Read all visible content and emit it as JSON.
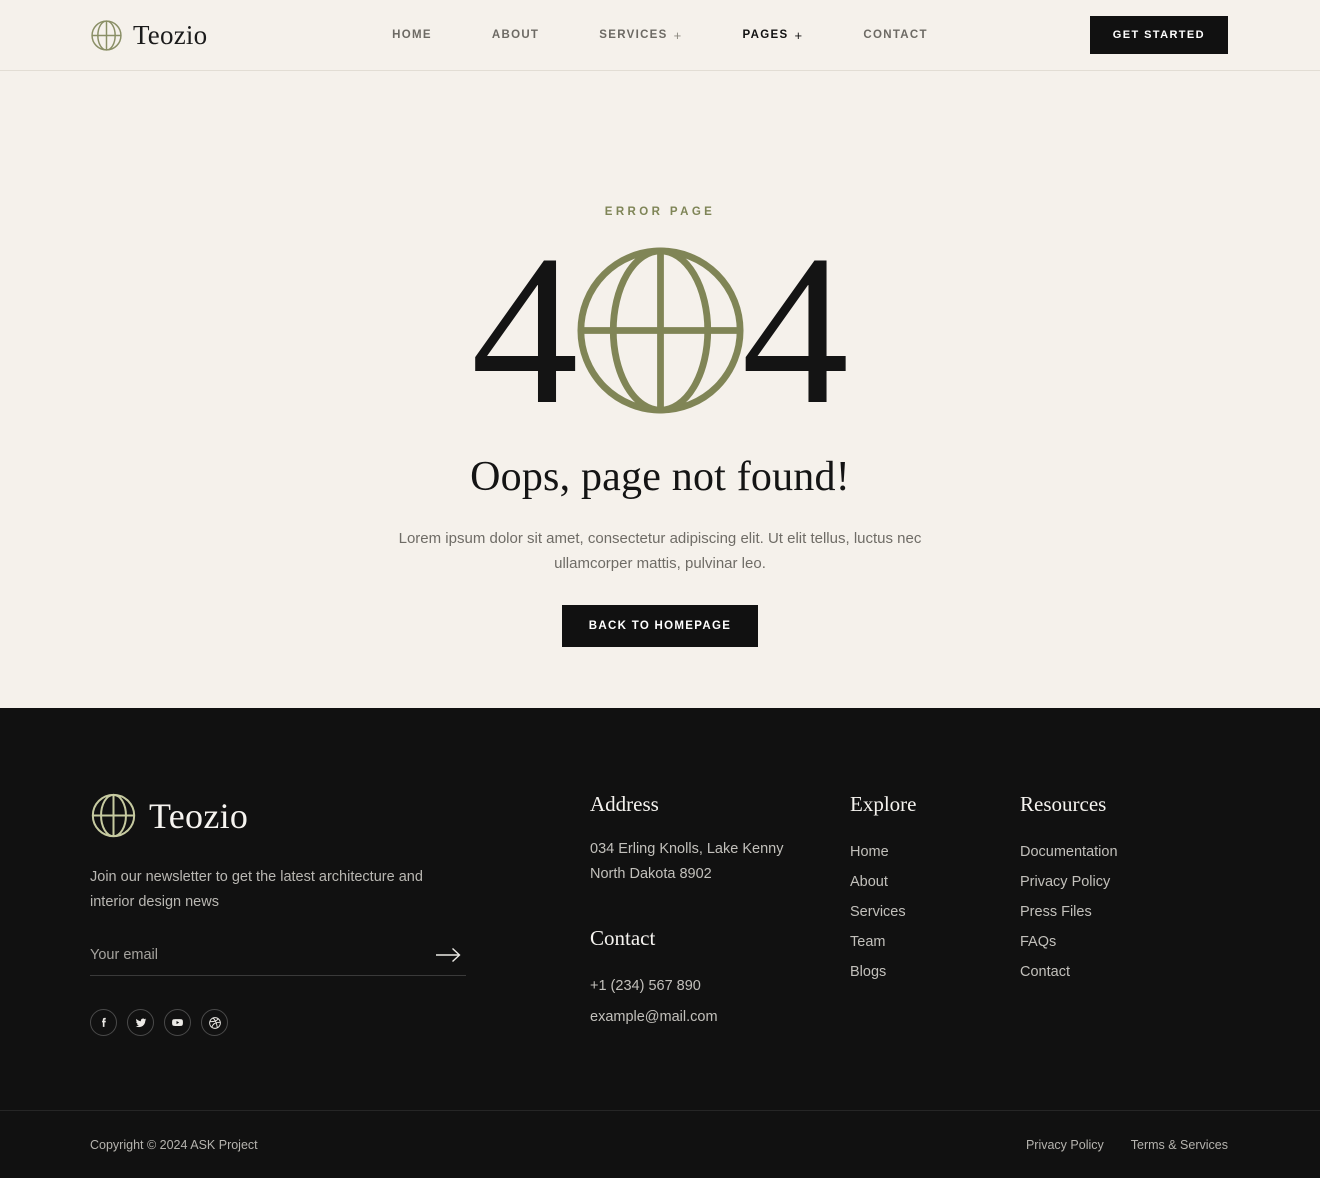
{
  "brand": {
    "name": "Teozio",
    "mark_icon": "circle-cross-logo-icon"
  },
  "header": {
    "nav": [
      {
        "label": "HOME",
        "has_plus": false,
        "active": false
      },
      {
        "label": "ABOUT",
        "has_plus": false,
        "active": false
      },
      {
        "label": "SERVICES",
        "has_plus": true,
        "active": false
      },
      {
        "label": "PAGES",
        "has_plus": true,
        "active": true
      },
      {
        "label": "CONTACT",
        "has_plus": false,
        "active": false
      }
    ],
    "plus_glyph": "+",
    "cta_label": "GET STARTED"
  },
  "hero": {
    "eyebrow": "ERROR PAGE",
    "code_left": "4",
    "code_right": "4",
    "code_middle_icon": "circle-cross-logo-icon",
    "title": "Oops, page not found!",
    "description": "Lorem ipsum dolor sit amet, consectetur adipiscing elit. Ut elit tellus, luctus nec ullamcorper mattis, pulvinar leo.",
    "button_label": "BACK TO HOMEPAGE"
  },
  "footer": {
    "brand_name": "Teozio",
    "newsletter_text": "Join our newsletter to get the latest architecture and interior design news",
    "email_placeholder": "Your email",
    "email_value": "",
    "submit_icon": "arrow-right-icon",
    "socials": [
      {
        "name": "facebook-icon",
        "glyph": "f"
      },
      {
        "name": "twitter-icon",
        "glyph": "t"
      },
      {
        "name": "youtube-icon",
        "glyph": "y"
      },
      {
        "name": "dribbble-icon",
        "glyph": "d"
      }
    ],
    "address": {
      "heading": "Address",
      "line1": "034 Erling Knolls, Lake Kenny",
      "line2": "North Dakota 8902"
    },
    "contact": {
      "heading": "Contact",
      "phone": "+1 (234) 567 890",
      "email": "example@mail.com"
    },
    "explore": {
      "heading": "Explore",
      "links": [
        "Home",
        "About",
        "Services",
        "Team",
        "Blogs"
      ]
    },
    "resources": {
      "heading": "Resources",
      "links": [
        "Documentation",
        "Privacy Policy",
        "Press Files",
        "FAQs",
        "Contact"
      ]
    },
    "bottom": {
      "copyright": "Copyright © 2024 ASK Project",
      "links": [
        "Privacy Policy",
        "Terms & Services"
      ]
    }
  },
  "colors": {
    "background": "#f5f1eb",
    "dark": "#111111",
    "olive": "#7f8557",
    "footer_olive": "#c6caa0",
    "text": "#141414",
    "muted": "#6f6c66"
  }
}
